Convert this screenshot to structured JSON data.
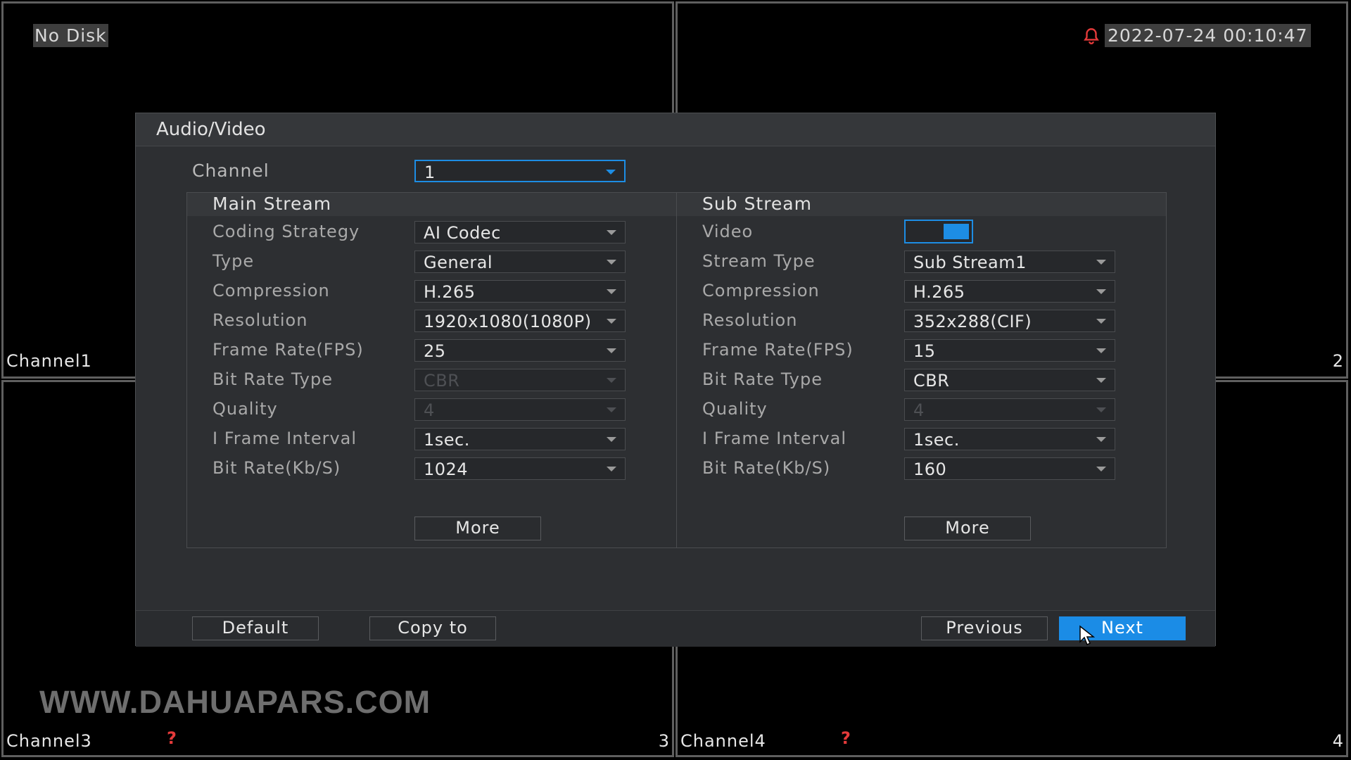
{
  "status": {
    "no_disk": "No Disk",
    "datetime": "2022-07-24 00:10:47",
    "alarm_icon": "bell-icon",
    "alarm_color": "#e43a3a"
  },
  "channels": [
    {
      "label": "Channel1",
      "number": "1"
    },
    {
      "label": "",
      "number": "2"
    },
    {
      "label": "Channel3",
      "number": "3",
      "alert": "?"
    },
    {
      "label": "Channel4",
      "number": "4",
      "alert": "?"
    }
  ],
  "watermark": "WWW.DAHUAPARS.COM",
  "dialog": {
    "title": "Audio/Video",
    "channel_label": "Channel",
    "channel_value": "1",
    "main_stream": {
      "title": "Main Stream",
      "rows": [
        {
          "label": "Coding Strategy",
          "value": "AI Codec",
          "disabled": false
        },
        {
          "label": "Type",
          "value": "General",
          "disabled": false
        },
        {
          "label": "Compression",
          "value": "H.265",
          "disabled": false
        },
        {
          "label": "Resolution",
          "value": "1920x1080(1080P)",
          "disabled": false
        },
        {
          "label": "Frame Rate(FPS)",
          "value": "25",
          "disabled": false
        },
        {
          "label": "Bit Rate Type",
          "value": "CBR",
          "disabled": true
        },
        {
          "label": "Quality",
          "value": "4",
          "disabled": true
        },
        {
          "label": "I Frame Interval",
          "value": "1sec.",
          "disabled": false
        },
        {
          "label": "Bit Rate(Kb/S)",
          "value": "1024",
          "disabled": false
        }
      ],
      "more_label": "More"
    },
    "sub_stream": {
      "title": "Sub Stream",
      "video_label": "Video",
      "video_enabled": true,
      "rows": [
        {
          "label": "Stream Type",
          "value": "Sub Stream1",
          "disabled": false
        },
        {
          "label": "Compression",
          "value": "H.265",
          "disabled": false
        },
        {
          "label": "Resolution",
          "value": "352x288(CIF)",
          "disabled": false
        },
        {
          "label": "Frame Rate(FPS)",
          "value": "15",
          "disabled": false
        },
        {
          "label": "Bit Rate Type",
          "value": "CBR",
          "disabled": false
        },
        {
          "label": "Quality",
          "value": "4",
          "disabled": true
        },
        {
          "label": "I Frame Interval",
          "value": "1sec.",
          "disabled": false
        },
        {
          "label": "Bit Rate(Kb/S)",
          "value": "160",
          "disabled": false
        }
      ],
      "more_label": "More"
    },
    "footer": {
      "default_label": "Default",
      "copy_label": "Copy to",
      "previous_label": "Previous",
      "next_label": "Next"
    },
    "accent_color": "#1b8ce6"
  }
}
